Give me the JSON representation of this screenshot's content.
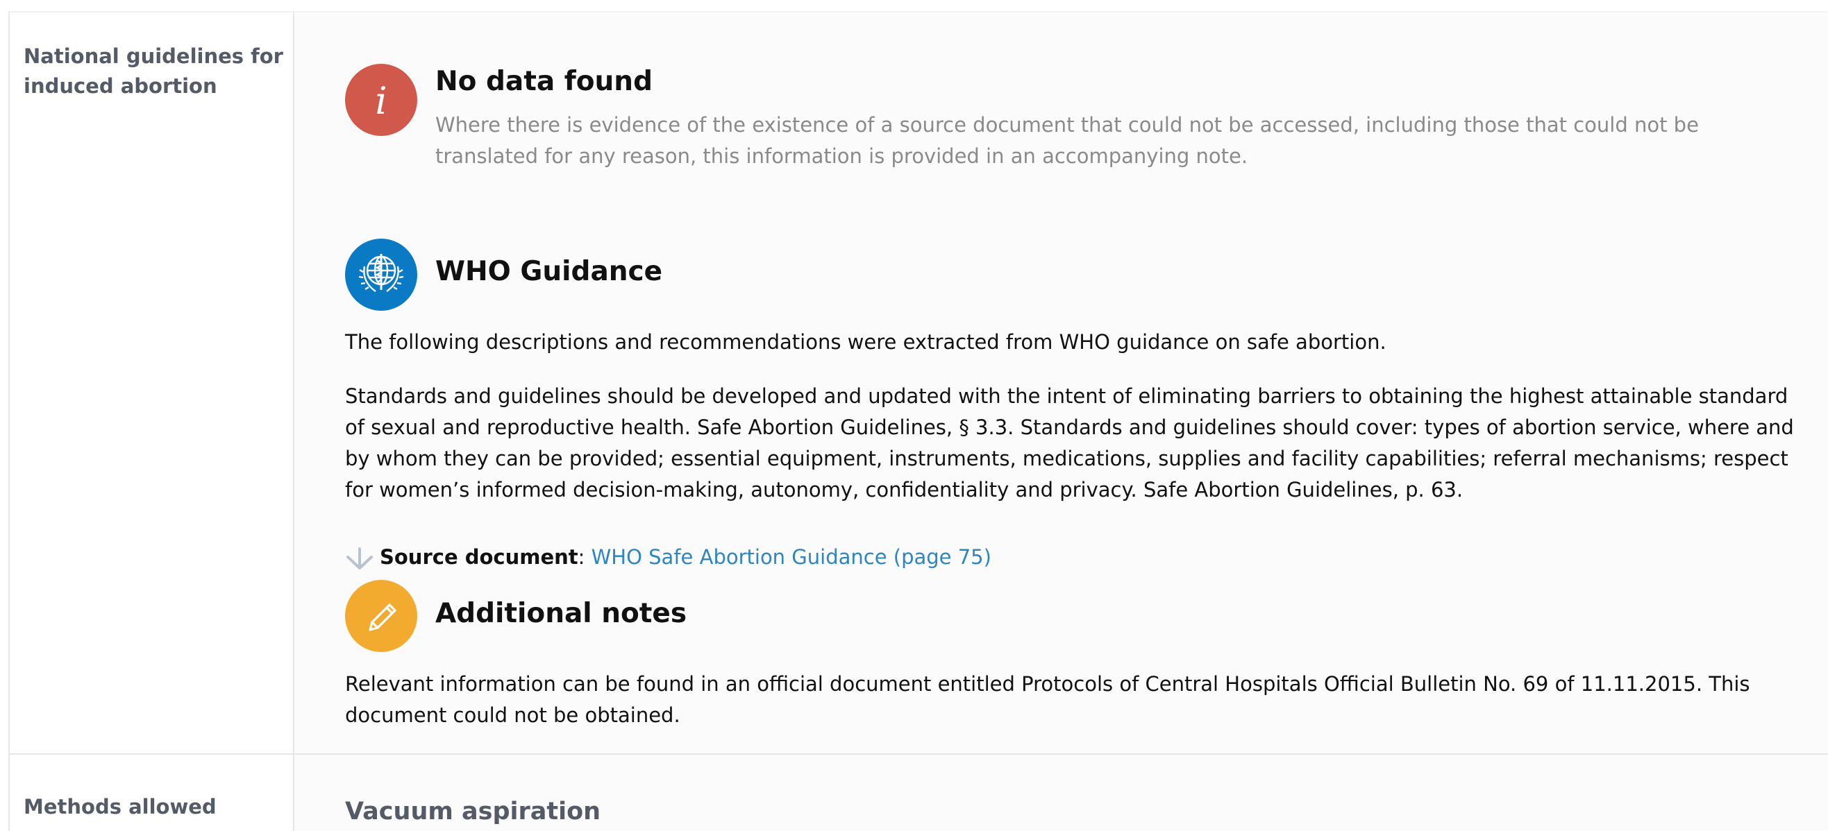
{
  "rows": [
    {
      "label": "National guidelines for induced abortion",
      "no_data": {
        "icon": "info-icon",
        "icon_color": "#d1594c",
        "title": "No data found",
        "description": "Where there is evidence of the existence of a source document that could not be accessed, including those that could not be translated for any reason, this information is provided in an accompanying note."
      },
      "who_guidance": {
        "icon": "who-emblem-icon",
        "icon_color": "#0a7ac4",
        "title": "WHO Guidance",
        "intro": "The following descriptions and recommendations were extracted from WHO guidance on safe abortion.",
        "body": "Standards and guidelines should be developed and updated with the intent of eliminating barriers to obtaining the highest attainable standard of sexual and reproductive health. Safe Abortion Guidelines, § 3.3. Standards and guidelines should cover: types of abortion service, where and by whom they can be provided; essential equipment, instruments, medications, supplies and facility capabilities; referral mechanisms; respect for women’s informed decision-making, autonomy, confidentiality and privacy. Safe Abortion Guidelines, p. 63.",
        "source_label": "Source document",
        "source_separator": ":",
        "source_link": "WHO Safe Abortion Guidance (page 75)"
      },
      "additional_notes": {
        "icon": "pencil-icon",
        "icon_color": "#f2ab2e",
        "title": "Additional notes",
        "text": "Relevant information can be found in an official document entitled Protocols of Central Hospitals Official Bulletin No. 69 of 11.11.2015. This document could not be obtained."
      }
    },
    {
      "label": "Methods allowed",
      "subheading": "Vacuum aspiration"
    }
  ],
  "colors": {
    "label_text": "#545b66",
    "link": "#2e86c1",
    "muted_text": "#8a8a8a"
  }
}
